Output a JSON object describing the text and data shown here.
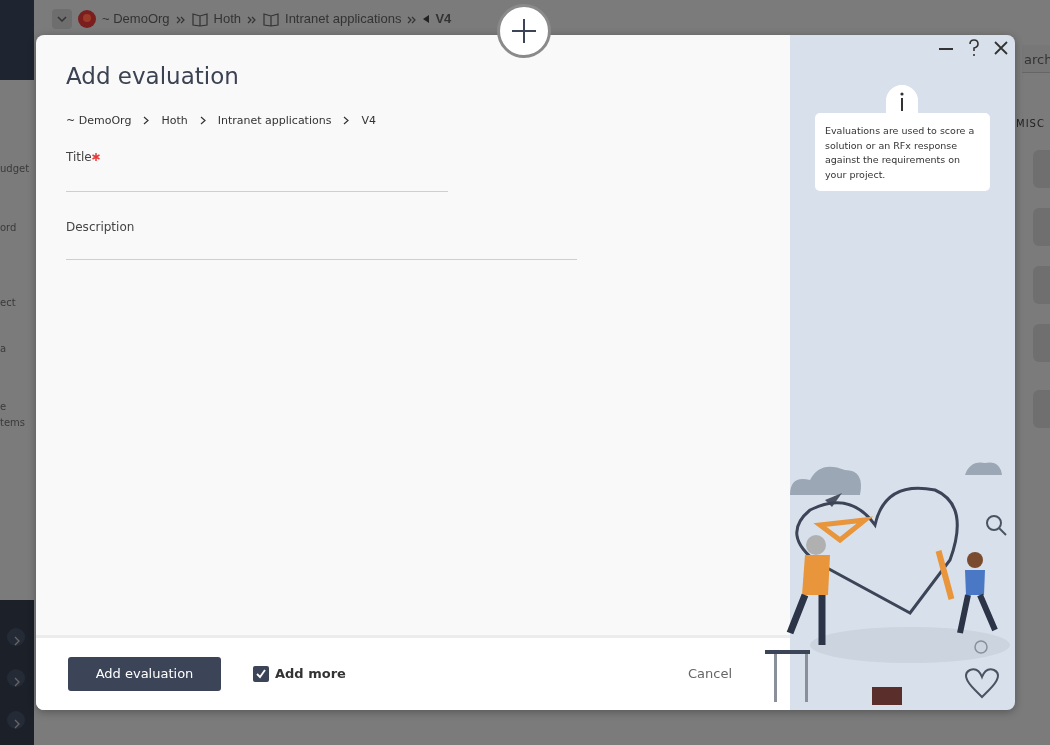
{
  "background": {
    "breadcrumb": [
      {
        "label": "~ DemoOrg",
        "kind": "org"
      },
      {
        "label": "Hoth",
        "kind": "book"
      },
      {
        "label": "Intranet applications",
        "kind": "book"
      },
      {
        "label": "V4",
        "kind": "current"
      }
    ],
    "sidebar_fragments": [
      "udget",
      "ord",
      "ect",
      "a",
      "e",
      "tems"
    ],
    "search_fragment": "arch",
    "section_label": "MISC"
  },
  "dialog": {
    "title": "Add evaluation",
    "breadcrumb": [
      "~ DemoOrg",
      "Hoth",
      "Intranet applications",
      "V4"
    ],
    "fields": [
      {
        "label": "Title",
        "required": true
      },
      {
        "label": "Description",
        "required": false
      }
    ],
    "info_text": "Evaluations are used to score a solution or an RFx response against the requirements on your project.",
    "primary_button": "Add evaluation",
    "add_more": {
      "label": "Add more",
      "checked": true
    },
    "cancel": "Cancel"
  }
}
